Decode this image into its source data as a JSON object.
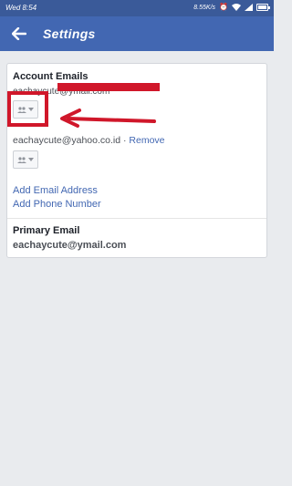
{
  "status_bar": {
    "time": "Wed 8:54",
    "network_speed": "8.55K/s",
    "icons": [
      "alarm-icon",
      "wifi-icon",
      "signal-icon",
      "battery-icon"
    ]
  },
  "app_bar": {
    "title": "Settings",
    "back_icon": "arrow-left-icon"
  },
  "account_emails": {
    "title": "Account Emails",
    "emails": [
      {
        "address": "eachaycute@ymail.com",
        "privacy_icon": "friends-icon"
      },
      {
        "address": "eachaycute@yahoo.co.id",
        "separator": "·",
        "action": "Remove",
        "privacy_icon": "friends-icon"
      }
    ],
    "add_email": "Add Email Address",
    "add_phone": "Add Phone Number"
  },
  "primary_email": {
    "title": "Primary Email",
    "value": "eachaycute@ymail.com"
  },
  "colors": {
    "app_bar": "#4267b2",
    "status_bar": "#3a5a99",
    "link": "#4267b2",
    "annotation": "#d0172a",
    "background": "#e9ebee"
  }
}
